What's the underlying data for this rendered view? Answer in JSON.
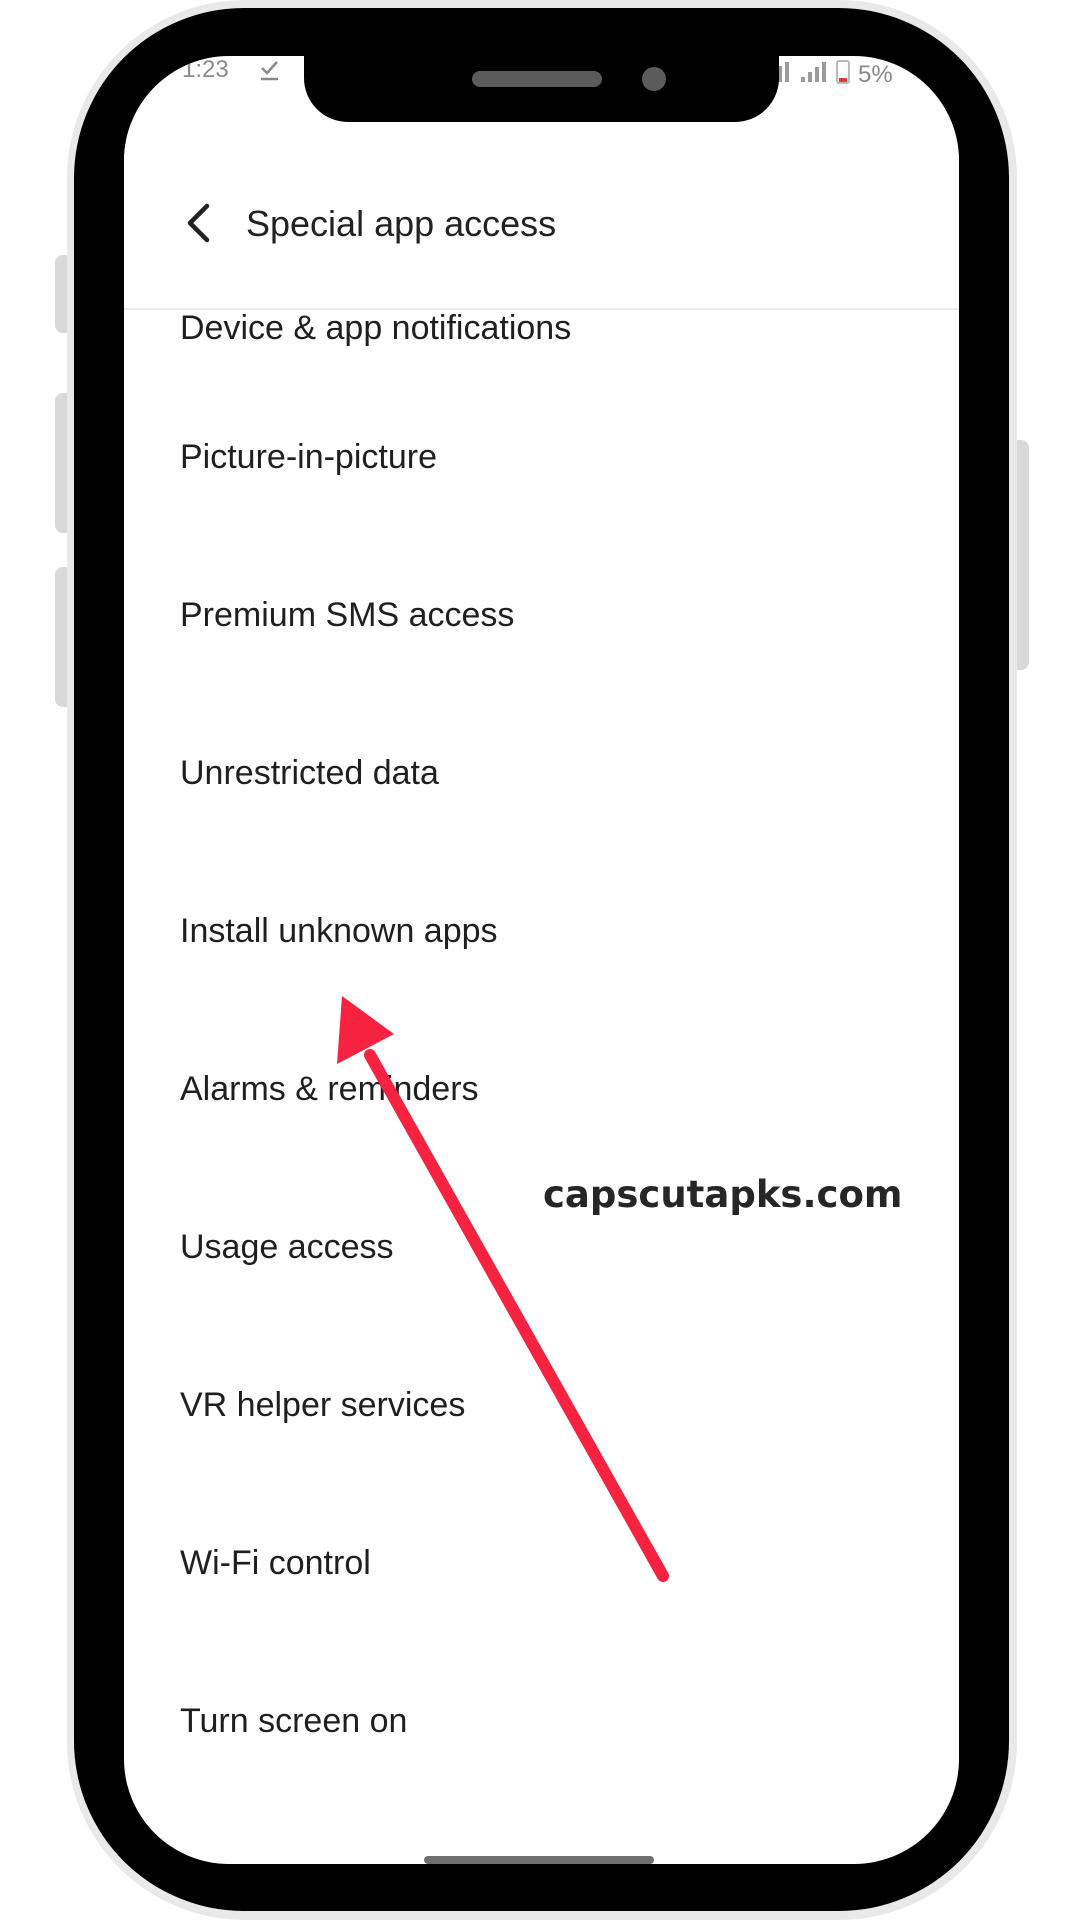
{
  "status_bar": {
    "time": "1:23",
    "battery_text": "5%"
  },
  "header": {
    "title": "Special app access"
  },
  "menu": {
    "items": [
      {
        "label": "Device & app notifications"
      },
      {
        "label": "Picture-in-picture"
      },
      {
        "label": "Premium SMS access"
      },
      {
        "label": "Unrestricted data"
      },
      {
        "label": "Install unknown apps"
      },
      {
        "label": "Alarms & reminders"
      },
      {
        "label": "Usage access"
      },
      {
        "label": "VR helper services"
      },
      {
        "label": "Wi-Fi control"
      },
      {
        "label": "Turn screen on"
      }
    ]
  },
  "overlay": {
    "watermark": "capscutapks.com",
    "arrow_color": "#f5233f",
    "arrow_target": "Install unknown apps"
  },
  "colors": {
    "frame": "#000000",
    "shell": "#e9e9e9",
    "screen": "#ffffff",
    "text": "#1f1f1f"
  }
}
